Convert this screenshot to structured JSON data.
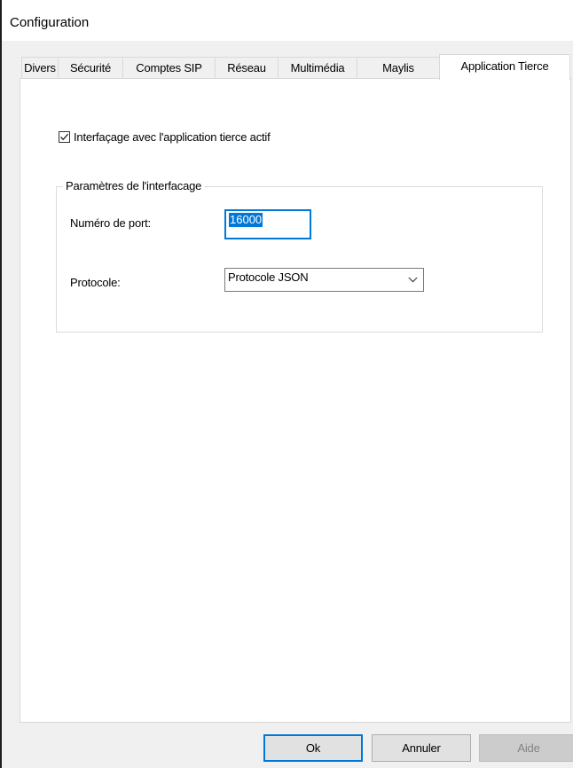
{
  "window": {
    "title": "Configuration"
  },
  "tabs": [
    {
      "label": "Divers",
      "active": false
    },
    {
      "label": "Sécurité",
      "active": false
    },
    {
      "label": "Comptes SIP",
      "active": false
    },
    {
      "label": "Réseau",
      "active": false
    },
    {
      "label": "Multimédia",
      "active": false
    },
    {
      "label": "Maylis",
      "active": false
    },
    {
      "label": "Application Tierce",
      "active": true
    }
  ],
  "panel": {
    "enable_checkbox": {
      "label": "Interfaçage avec l'application tierce actif",
      "checked": true
    },
    "group": {
      "legend": "Paramètres de l'interfacage",
      "port_label": "Numéro de port:",
      "port_value": "16000",
      "protocol_label": "Protocole:",
      "protocol_value": "Protocole JSON"
    }
  },
  "buttons": {
    "ok": "Ok",
    "cancel": "Annuler",
    "help": "Aide"
  },
  "colors": {
    "accent": "#0078d7",
    "tab_border": "#d9d9d9",
    "panel_background": "#ffffff",
    "dialog_background": "#f0f0f0"
  },
  "icons": {
    "checkbox_checked": "check-icon",
    "dropdown": "chevron-down-icon"
  }
}
